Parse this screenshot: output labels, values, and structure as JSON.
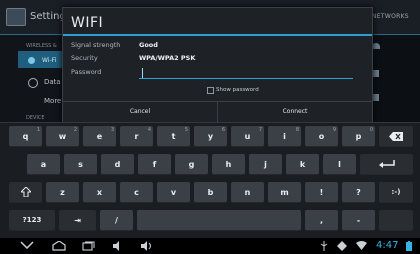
{
  "background": {
    "title": "Settings",
    "networks_label": "NETWORKS",
    "section_wireless": "WIRELESS &",
    "wifi_item": "Wi-Fi",
    "data_item": "Data",
    "more_item": "More",
    "section_device": "DEVICE"
  },
  "dialog": {
    "title": "WIFI",
    "signal_label": "Signal strength",
    "signal_value": "Good",
    "security_label": "Security",
    "security_value": "WPA/WPA2 PSK",
    "password_label": "Password",
    "password_value": "",
    "show_password_label": "Show password",
    "cancel_label": "Cancel",
    "connect_label": "Connect"
  },
  "keyboard": {
    "row1": [
      "q",
      "w",
      "e",
      "r",
      "t",
      "y",
      "u",
      "i",
      "o",
      "p"
    ],
    "row2": [
      "a",
      "s",
      "d",
      "f",
      "g",
      "h",
      "j",
      "k",
      "l"
    ],
    "row3": [
      "z",
      "x",
      "c",
      "v",
      "b",
      "n",
      "m",
      "!",
      "?"
    ],
    "smiley": ":-)",
    "symbols_label": "?123",
    "slash": "/",
    "tab_label": "⇥",
    "comma": ",",
    "dash": "-",
    "backspace_icon": "backspace-icon",
    "enter_icon": "enter-icon",
    "shift_icon": "shift-icon",
    "r1_subs": [
      "1",
      "2",
      "3",
      "4",
      "5",
      "6",
      "7",
      "8",
      "9",
      "0"
    ]
  },
  "status": {
    "clock": "4:47"
  },
  "colors": {
    "accent": "#2aa0d4",
    "clock": "#35b5e5"
  }
}
